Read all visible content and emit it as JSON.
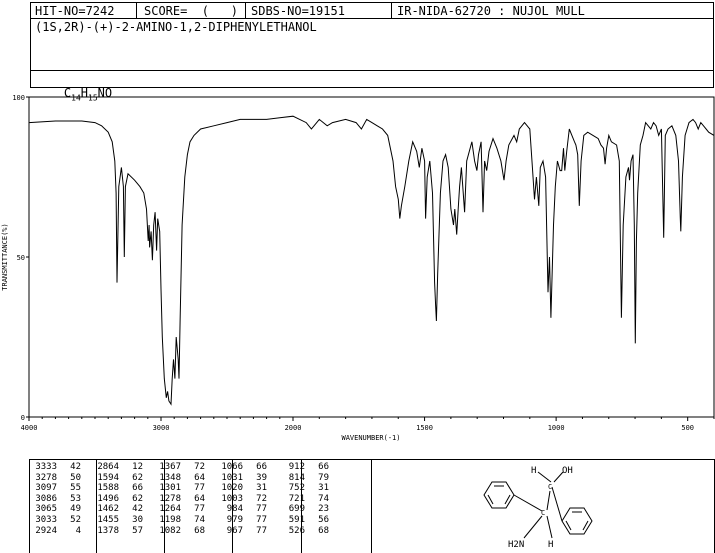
{
  "header": {
    "hit_no": "HIT-NO=7242",
    "score": "SCORE=  (   )",
    "sdbs_no": "SDBS-NO=19151",
    "ir_info": "IR-NIDA-62720 : NUJOL MULL",
    "compound_name": "(1S,2R)-(+)-2-AMINO-1,2-DIPHENYLETHANOL",
    "formula_parts": [
      "C",
      "14",
      "H",
      "15",
      "NO"
    ]
  },
  "chart_data": {
    "type": "line",
    "xlabel": "WAVENUMBER(-1)",
    "ylabel": "TRANSMITTANCE(%)",
    "xlim": [
      4000,
      400
    ],
    "ylim": [
      0,
      100
    ],
    "xticks": [
      4000,
      3000,
      2000,
      1500,
      1000,
      500
    ],
    "yticks": [
      0,
      50,
      100
    ],
    "series": [
      {
        "points": [
          [
            4000,
            92
          ],
          [
            3800,
            92.5
          ],
          [
            3600,
            92.5
          ],
          [
            3500,
            92
          ],
          [
            3450,
            91
          ],
          [
            3400,
            89
          ],
          [
            3370,
            86
          ],
          [
            3350,
            80
          ],
          [
            3340,
            70
          ],
          [
            3333,
            42
          ],
          [
            3320,
            72
          ],
          [
            3300,
            78
          ],
          [
            3285,
            72
          ],
          [
            3278,
            50
          ],
          [
            3270,
            72
          ],
          [
            3250,
            76
          ],
          [
            3200,
            74
          ],
          [
            3160,
            72
          ],
          [
            3130,
            70
          ],
          [
            3110,
            65
          ],
          [
            3097,
            55
          ],
          [
            3090,
            60
          ],
          [
            3086,
            53
          ],
          [
            3075,
            58
          ],
          [
            3065,
            49
          ],
          [
            3055,
            60
          ],
          [
            3045,
            64
          ],
          [
            3033,
            52
          ],
          [
            3025,
            62
          ],
          [
            3010,
            58
          ],
          [
            3000,
            40
          ],
          [
            2990,
            25
          ],
          [
            2975,
            12
          ],
          [
            2960,
            6
          ],
          [
            2950,
            8
          ],
          [
            2940,
            5
          ],
          [
            2924,
            4
          ],
          [
            2915,
            12
          ],
          [
            2905,
            18
          ],
          [
            2895,
            12
          ],
          [
            2885,
            25
          ],
          [
            2870,
            18
          ],
          [
            2864,
            12
          ],
          [
            2855,
            30
          ],
          [
            2840,
            60
          ],
          [
            2820,
            75
          ],
          [
            2800,
            82
          ],
          [
            2780,
            86
          ],
          [
            2750,
            88
          ],
          [
            2700,
            90
          ],
          [
            2600,
            91
          ],
          [
            2500,
            92
          ],
          [
            2400,
            93
          ],
          [
            2300,
            93
          ],
          [
            2200,
            93
          ],
          [
            2100,
            93.5
          ],
          [
            2000,
            94
          ],
          [
            1950,
            92
          ],
          [
            1930,
            90
          ],
          [
            1900,
            93
          ],
          [
            1870,
            91
          ],
          [
            1850,
            92
          ],
          [
            1800,
            93
          ],
          [
            1760,
            92
          ],
          [
            1740,
            90
          ],
          [
            1720,
            93
          ],
          [
            1700,
            92
          ],
          [
            1680,
            91
          ],
          [
            1660,
            90
          ],
          [
            1640,
            88
          ],
          [
            1620,
            80
          ],
          [
            1610,
            72
          ],
          [
            1600,
            68
          ],
          [
            1594,
            62
          ],
          [
            1588,
            66
          ],
          [
            1575,
            72
          ],
          [
            1560,
            80
          ],
          [
            1545,
            86
          ],
          [
            1530,
            83
          ],
          [
            1520,
            78
          ],
          [
            1510,
            84
          ],
          [
            1500,
            80
          ],
          [
            1496,
            62
          ],
          [
            1490,
            75
          ],
          [
            1480,
            80
          ],
          [
            1470,
            70
          ],
          [
            1462,
            42
          ],
          [
            1458,
            35
          ],
          [
            1455,
            30
          ],
          [
            1450,
            45
          ],
          [
            1440,
            70
          ],
          [
            1430,
            80
          ],
          [
            1420,
            82
          ],
          [
            1410,
            78
          ],
          [
            1400,
            65
          ],
          [
            1390,
            60
          ],
          [
            1385,
            65
          ],
          [
            1378,
            57
          ],
          [
            1372,
            65
          ],
          [
            1367,
            72
          ],
          [
            1360,
            78
          ],
          [
            1348,
            64
          ],
          [
            1340,
            80
          ],
          [
            1320,
            86
          ],
          [
            1310,
            80
          ],
          [
            1301,
            77
          ],
          [
            1295,
            82
          ],
          [
            1285,
            86
          ],
          [
            1278,
            64
          ],
          [
            1272,
            80
          ],
          [
            1264,
            77
          ],
          [
            1255,
            83
          ],
          [
            1240,
            87
          ],
          [
            1225,
            84
          ],
          [
            1210,
            80
          ],
          [
            1198,
            74
          ],
          [
            1190,
            80
          ],
          [
            1180,
            85
          ],
          [
            1160,
            88
          ],
          [
            1150,
            86
          ],
          [
            1140,
            90
          ],
          [
            1120,
            92
          ],
          [
            1100,
            90
          ],
          [
            1090,
            78
          ],
          [
            1082,
            68
          ],
          [
            1075,
            75
          ],
          [
            1066,
            66
          ],
          [
            1060,
            78
          ],
          [
            1050,
            80
          ],
          [
            1040,
            75
          ],
          [
            1031,
            39
          ],
          [
            1025,
            50
          ],
          [
            1020,
            31
          ],
          [
            1010,
            60
          ],
          [
            1003,
            72
          ],
          [
            995,
            80
          ],
          [
            985,
            77
          ],
          [
            979,
            77
          ],
          [
            972,
            84
          ],
          [
            967,
            77
          ],
          [
            960,
            83
          ],
          [
            950,
            90
          ],
          [
            940,
            88
          ],
          [
            930,
            86
          ],
          [
            925,
            85
          ],
          [
            918,
            82
          ],
          [
            912,
            66
          ],
          [
            905,
            80
          ],
          [
            895,
            88
          ],
          [
            880,
            89
          ],
          [
            860,
            88
          ],
          [
            840,
            87
          ],
          [
            830,
            85
          ],
          [
            820,
            84
          ],
          [
            814,
            79
          ],
          [
            808,
            84
          ],
          [
            800,
            88
          ],
          [
            790,
            86
          ],
          [
            770,
            85
          ],
          [
            760,
            80
          ],
          [
            752,
            31
          ],
          [
            745,
            60
          ],
          [
            735,
            75
          ],
          [
            725,
            78
          ],
          [
            721,
            74
          ],
          [
            715,
            80
          ],
          [
            708,
            82
          ],
          [
            703,
            60
          ],
          [
            699,
            23
          ],
          [
            695,
            55
          ],
          [
            690,
            70
          ],
          [
            680,
            85
          ],
          [
            670,
            88
          ],
          [
            660,
            92
          ],
          [
            650,
            91
          ],
          [
            640,
            90
          ],
          [
            630,
            92
          ],
          [
            620,
            91
          ],
          [
            610,
            88
          ],
          [
            600,
            90
          ],
          [
            591,
            56
          ],
          [
            585,
            88
          ],
          [
            575,
            90
          ],
          [
            560,
            91
          ],
          [
            545,
            88
          ],
          [
            535,
            80
          ],
          [
            528,
            62
          ],
          [
            526,
            58
          ],
          [
            520,
            75
          ],
          [
            510,
            88
          ],
          [
            495,
            92
          ],
          [
            480,
            93
          ],
          [
            470,
            92
          ],
          [
            460,
            90
          ],
          [
            450,
            92
          ],
          [
            440,
            91
          ],
          [
            430,
            90
          ],
          [
            420,
            89
          ],
          [
            400,
            88
          ]
        ]
      }
    ]
  },
  "peak_table": {
    "columns": [
      [
        [
          "3333",
          "42"
        ],
        [
          "3278",
          "50"
        ],
        [
          "3097",
          "55"
        ],
        [
          "3086",
          "53"
        ],
        [
          "3065",
          "49"
        ],
        [
          "3033",
          "52"
        ],
        [
          "2924",
          "4"
        ]
      ],
      [
        [
          "2864",
          "12"
        ],
        [
          "1594",
          "62"
        ],
        [
          "1588",
          "66"
        ],
        [
          "1496",
          "62"
        ],
        [
          "1462",
          "42"
        ],
        [
          "1455",
          "30"
        ],
        [
          "1378",
          "57"
        ]
      ],
      [
        [
          "1367",
          "72"
        ],
        [
          "1348",
          "64"
        ],
        [
          "1301",
          "77"
        ],
        [
          "1278",
          "64"
        ],
        [
          "1264",
          "77"
        ],
        [
          "1198",
          "74"
        ],
        [
          "1082",
          "68"
        ]
      ],
      [
        [
          "1066",
          "66"
        ],
        [
          "1031",
          "39"
        ],
        [
          "1020",
          "31"
        ],
        [
          "1003",
          "72"
        ],
        [
          "984",
          "77"
        ],
        [
          "979",
          "77"
        ],
        [
          "967",
          "77"
        ]
      ],
      [
        [
          "912",
          "66"
        ],
        [
          "814",
          "79"
        ],
        [
          "752",
          "31"
        ],
        [
          "721",
          "74"
        ],
        [
          "699",
          "23"
        ],
        [
          "591",
          "56"
        ],
        [
          "526",
          "68"
        ]
      ]
    ]
  },
  "structure": {
    "labels": [
      "H",
      "OH",
      "C",
      "C",
      "H2N",
      "H"
    ]
  }
}
